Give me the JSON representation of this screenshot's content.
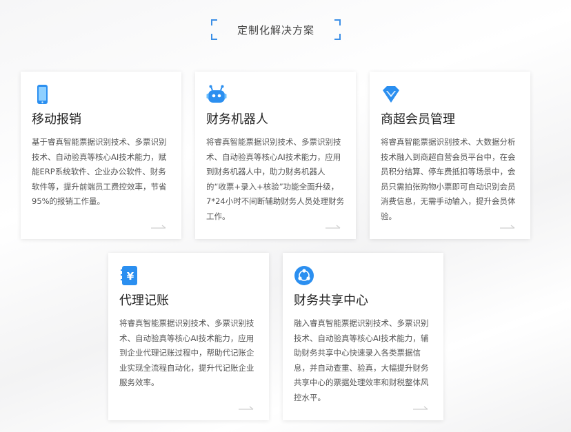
{
  "section_title": "定制化解决方案",
  "cards": [
    {
      "icon": "mobile-phone-icon",
      "title": "移动报销",
      "desc": "基于睿真智能票据识别技术、多票识别技术、自动验真等核心AI技术能力，赋能ERP系统软件、企业办公软件、财务软件等，提升前端员工费控效率，节省95%的报销工作量。"
    },
    {
      "icon": "robot-icon",
      "title": "财务机器人",
      "desc": "将睿真智能票据识别技术、多票识别技术、自动验真等核心AI技术能力，应用到财务机器人中，助力财务机器人的“收票+录入+核验”功能全面升级，7*24小时不间断辅助财务人员处理财务工作。"
    },
    {
      "icon": "diamond-icon",
      "title": "商超会员管理",
      "desc": "将睿真智能票据识别技术、大数据分析技术融入到商超自营会员平台中，在会员积分结算、停车费抵扣等场景中，会员只需拍张购物小票即可自动识别会员消费信息，无需手动输入，提升会员体验。"
    },
    {
      "icon": "ledger-yen-icon",
      "title": "代理记账",
      "desc": "将睿真智能票据识别技术、多票识别技术、自动验真等核心AI技术能力，应用到企业代理记账过程中，帮助代记账企业实现全流程自动化，提升代记账企业服务效率。"
    },
    {
      "icon": "share-network-icon",
      "title": "财务共享中心",
      "desc": "融入睿真智能票据识别技术、多票识别技术、自动验真等核心AI技术能力，辅助财务共享中心快速录入各类票据信息，并自动查重、验真，大幅提升财务共享中心的票据处理效率和财税整体风控水平。"
    }
  ]
}
